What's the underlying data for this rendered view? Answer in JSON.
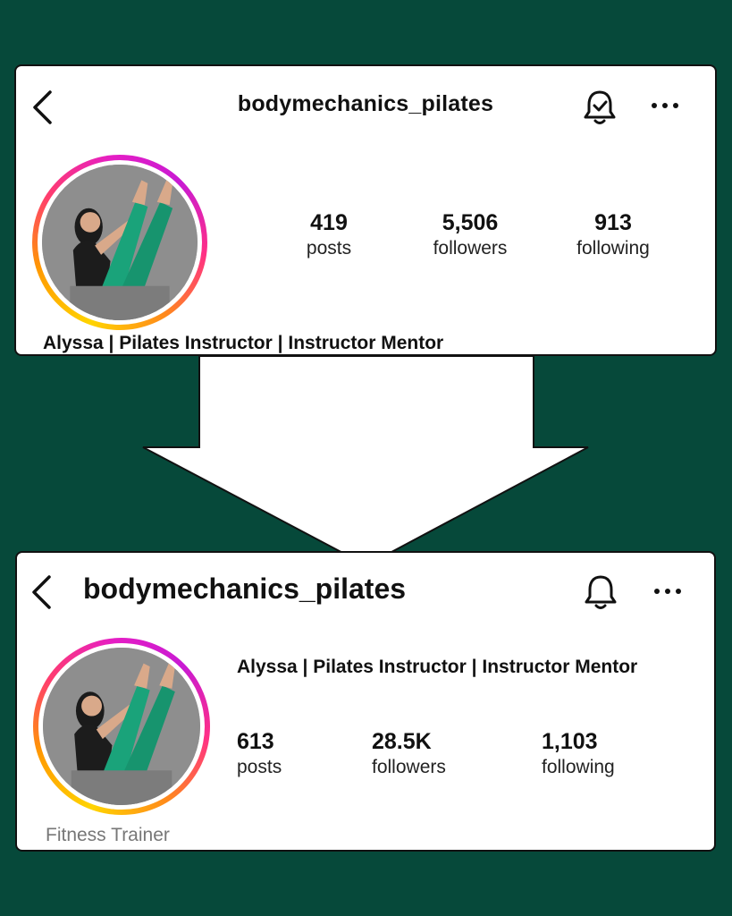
{
  "before": {
    "username": "bodymechanics_pilates",
    "stats": [
      {
        "value": "419",
        "label": "posts"
      },
      {
        "value": "5,506",
        "label": "followers"
      },
      {
        "value": "913",
        "label": "following"
      }
    ],
    "display_name": "Alyssa | Pilates Instructor | Instructor Mentor",
    "icons": {
      "back": "chevron-left-icon",
      "bell": "bell-check-icon",
      "more": "more-horizontal-icon"
    }
  },
  "after": {
    "username": "bodymechanics_pilates",
    "display_name": "Alyssa | Pilates Instructor | Instructor Mentor",
    "stats": [
      {
        "value": "613",
        "label": "posts"
      },
      {
        "value": "28.5K",
        "label": "followers"
      },
      {
        "value": "1,103",
        "label": "following"
      }
    ],
    "category": "Fitness Trainer",
    "icons": {
      "back": "chevron-left-icon",
      "bell": "bell-icon",
      "more": "more-horizontal-icon"
    }
  },
  "colors": {
    "background": "#06493a",
    "card": "#ffffff",
    "ring_start": "#ffd400",
    "ring_end": "#c81ad3",
    "leggings": "#1aa37a"
  }
}
